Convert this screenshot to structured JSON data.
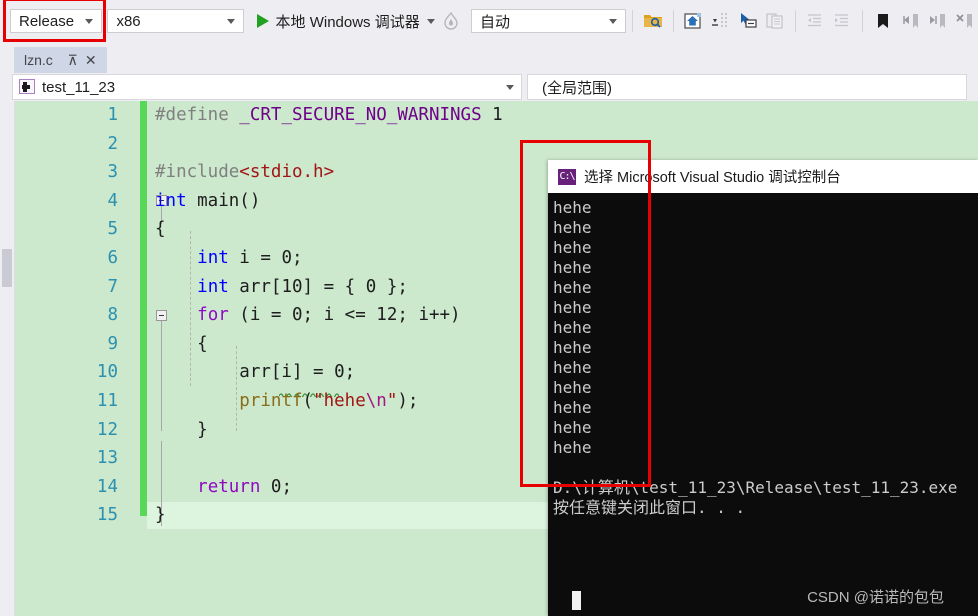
{
  "toolbar": {
    "configuration": "Release",
    "platform": "x86",
    "debugger_label": "本地 Windows 调试器",
    "auto_label": "自动",
    "icons": [
      "folder-search-icon",
      "home-icon",
      "dropdown-more-icon",
      "pointer-select-icon",
      "copy-lines-icon",
      "decrease-indent-icon",
      "increase-indent-icon",
      "bookmark-icon",
      "previous-bookmark-icon",
      "next-bookmark-icon",
      "clear-bookmarks-icon"
    ]
  },
  "tab": {
    "filename": "lzn.c",
    "pin_glyph": "⊼",
    "close_glyph": "✕"
  },
  "navbar": {
    "project": "test_11_23",
    "scope": "(全局范围)"
  },
  "editor": {
    "lines": [
      {
        "n": "1",
        "segments": [
          {
            "t": "#define ",
            "c": "t-pre"
          },
          {
            "t": "_CRT_SECURE_NO_WARNINGS",
            "c": "t-macro"
          },
          {
            "t": " 1",
            "c": "t-num"
          }
        ]
      },
      {
        "n": "2",
        "segments": []
      },
      {
        "n": "3",
        "segments": [
          {
            "t": "#include",
            "c": "t-pre"
          },
          {
            "t": "<stdio.h>",
            "c": "t-hdr"
          }
        ]
      },
      {
        "n": "4",
        "segments": [
          {
            "t": "int",
            "c": "t-kw"
          },
          {
            "t": " main()",
            "c": "t-plain"
          }
        ]
      },
      {
        "n": "5",
        "segments": [
          {
            "t": "{",
            "c": "t-plain"
          }
        ]
      },
      {
        "n": "6",
        "segments": [
          {
            "t": "    ",
            "c": "t-plain"
          },
          {
            "t": "int",
            "c": "t-kw"
          },
          {
            "t": " i = ",
            "c": "t-plain"
          },
          {
            "t": "0",
            "c": "t-num"
          },
          {
            "t": ";",
            "c": "t-plain"
          }
        ]
      },
      {
        "n": "7",
        "segments": [
          {
            "t": "    ",
            "c": "t-plain"
          },
          {
            "t": "int",
            "c": "t-kw"
          },
          {
            "t": " arr[",
            "c": "t-plain"
          },
          {
            "t": "10",
            "c": "t-num"
          },
          {
            "t": "] = { ",
            "c": "t-plain"
          },
          {
            "t": "0",
            "c": "t-num"
          },
          {
            "t": " };",
            "c": "t-plain"
          }
        ]
      },
      {
        "n": "8",
        "segments": [
          {
            "t": "    ",
            "c": "t-plain"
          },
          {
            "t": "for",
            "c": "t-kwp"
          },
          {
            "t": " (i = ",
            "c": "t-plain"
          },
          {
            "t": "0",
            "c": "t-num"
          },
          {
            "t": "; i <= ",
            "c": "t-plain"
          },
          {
            "t": "12",
            "c": "t-num"
          },
          {
            "t": "; i++)",
            "c": "t-plain"
          }
        ]
      },
      {
        "n": "9",
        "segments": [
          {
            "t": "    {",
            "c": "t-plain"
          }
        ]
      },
      {
        "n": "10",
        "segments": [
          {
            "t": "        arr[i] = ",
            "c": "t-plain"
          },
          {
            "t": "0",
            "c": "t-num"
          },
          {
            "t": ";",
            "c": "t-plain"
          }
        ]
      },
      {
        "n": "11",
        "segments": [
          {
            "t": "        ",
            "c": "t-plain"
          },
          {
            "t": "printf",
            "c": "t-fn"
          },
          {
            "t": "(",
            "c": "t-plain"
          },
          {
            "t": "\"hehe",
            "c": "t-str"
          },
          {
            "t": "\\n",
            "c": "t-esc"
          },
          {
            "t": "\"",
            "c": "t-str"
          },
          {
            "t": ");",
            "c": "t-plain"
          }
        ]
      },
      {
        "n": "12",
        "segments": [
          {
            "t": "    }",
            "c": "t-plain"
          }
        ]
      },
      {
        "n": "13",
        "segments": []
      },
      {
        "n": "14",
        "segments": [
          {
            "t": "    ",
            "c": "t-plain"
          },
          {
            "t": "return",
            "c": "t-kwp"
          },
          {
            "t": " ",
            "c": "t-plain"
          },
          {
            "t": "0",
            "c": "t-num"
          },
          {
            "t": ";",
            "c": "t-plain"
          }
        ]
      },
      {
        "n": "15",
        "segments": [
          {
            "t": "}",
            "c": "t-plain"
          }
        ]
      }
    ],
    "current_line": "15"
  },
  "console": {
    "title": "选择 Microsoft Visual Studio 调试控制台",
    "icon_text": "C:\\",
    "output_lines": [
      "hehe",
      "hehe",
      "hehe",
      "hehe",
      "hehe",
      "hehe",
      "hehe",
      "hehe",
      "hehe",
      "hehe",
      "hehe",
      "hehe",
      "hehe"
    ],
    "exe_path": "D:\\计算机\\test_11_23\\Release\\test_11_23.exe",
    "press_key": "按任意键关闭此窗口. . .",
    "watermark": "CSDN @诺诺的包包"
  },
  "annotations": {
    "highlight_color": "#e60000",
    "boxes": [
      "release-config-highlight",
      "console-output-highlight"
    ]
  }
}
